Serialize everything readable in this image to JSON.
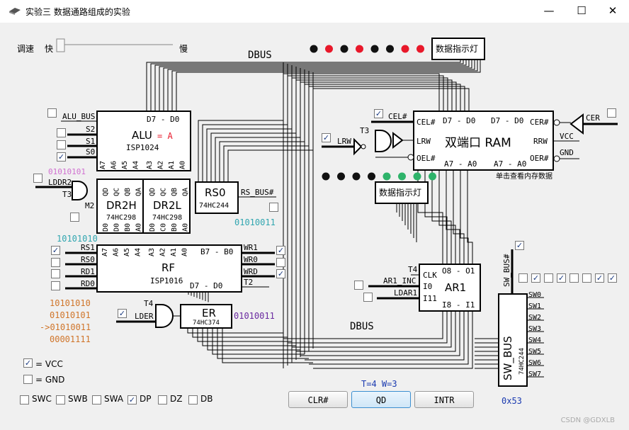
{
  "window": {
    "title": "实验三 数据通路组成的实验",
    "min": "—",
    "max": "☐",
    "close": "✕"
  },
  "speed": {
    "label": "调速",
    "fast": "快",
    "slow": "慢",
    "value": 0
  },
  "labels": {
    "dbus_top": "DBUS",
    "dbus_bottom": "DBUS",
    "indicator_top": "数据指示灯",
    "indicator_bottom": "数据指示灯",
    "alu_bus": "ALU_BUS",
    "s2": "S2",
    "s1": "S1",
    "s0": "S0",
    "alu_title": "ALU",
    "alu_eq": "= A",
    "alu_chip": "ISP1024",
    "alu_d": "D7 - D0",
    "alu_pins": [
      "A7",
      "A6",
      "A5",
      "A4",
      "A3",
      "A2",
      "A1",
      "A0"
    ],
    "bin_alu": "01010101",
    "lddr2": "LDDR2",
    "t3": "T3",
    "m2": "M2",
    "dr2h": "DR2H",
    "dr2l": "DR2L",
    "chip_298": "74HC298",
    "dr_top_pins": [
      "QD",
      "QC",
      "QB",
      "QA",
      "QD",
      "QC",
      "QB",
      "QA"
    ],
    "dr_bot_pins": [
      "D0",
      "D0",
      "B0",
      "A0",
      "D0",
      "C0",
      "B0",
      "A0"
    ],
    "rs0": "RS0",
    "rs0_chip": "74HC244",
    "rs_bus": "RS_BUS#",
    "rs0_val": "01010011",
    "rf_val": "10101010",
    "rs1": "RS1",
    "rs0_in": "RS0",
    "rd1": "RD1",
    "rd0": "RD0",
    "rf_title": "RF",
    "rf_chip": "ISP1016",
    "rf_d": "D7 - D0",
    "rf_b": "B7 - B0",
    "rf_pins": [
      "A7",
      "A6",
      "A5",
      "A4",
      "A3",
      "A2",
      "A1",
      "A0"
    ],
    "wr1": "WR1",
    "wr0": "WR0",
    "wrd": "WRD",
    "t2": "T2",
    "regs": [
      "10101010",
      "01010101",
      "->01010011",
      "00001111"
    ],
    "t4": "T4",
    "lder": "LDER",
    "er": "ER",
    "er_chip": "74HC374",
    "er_val": "01010011",
    "vcc_legend": "= VCC",
    "gnd_legend": "= GND",
    "cel": "CEL#",
    "lrw": "LRW",
    "t3b": "T3",
    "ram_title": "双端口 RAM",
    "ram_d1": "D7 - D0",
    "ram_d2": "D7 - D0",
    "ram_a1": "A7 - A0",
    "ram_a2": "A7 - A0",
    "ram_cel": "CEL#",
    "ram_lrw": "LRW",
    "ram_oel": "OEL#",
    "ram_cer": "CER#",
    "ram_rrw": "RRW",
    "ram_oer": "OER#",
    "cer": "CER",
    "vcc": "VCC",
    "gnd": "GND",
    "mem_hint": "单击查看内存数据",
    "ar1": "AR1",
    "ar1_inc": "AR1_INC",
    "ldar1": "LDAR1",
    "t4b": "T4",
    "ar1_clk": "CLK",
    "ar1_i0": "I0",
    "ar1_i11": "I11",
    "ar1_o": "O8 - O1",
    "ar1_i": "I8 - I1",
    "swbus": "SW_BUS",
    "swbus_chip": "74HC244",
    "swbus_en": "SW_BUS#",
    "sw": [
      "SW0",
      "SW1",
      "SW2",
      "SW3",
      "SW4",
      "SW5",
      "SW6",
      "SW7"
    ],
    "sw_val": "0x53",
    "tw": "T=4  W=3"
  },
  "checkboxes_bottom": [
    {
      "label": "SWC",
      "checked": false
    },
    {
      "label": "SWB",
      "checked": false
    },
    {
      "label": "SWA",
      "checked": false
    },
    {
      "label": "DP",
      "checked": true
    },
    {
      "label": "DZ",
      "checked": false
    },
    {
      "label": "DB",
      "checked": false
    }
  ],
  "switches": [
    false,
    true,
    false,
    true,
    false,
    false,
    true,
    true
  ],
  "leds_top": [
    "#111111",
    "#e8182a",
    "#111111",
    "#e8182a",
    "#111111",
    "#111111",
    "#e8182a",
    "#e8182a"
  ],
  "leds_bottom": [
    "#111111",
    "#111111",
    "#111111",
    "#111111",
    "#2eb36a",
    "#2eb36a",
    "#2eb36a",
    "#2eb36a"
  ],
  "buttons": {
    "clr": "CLR#",
    "qd": "QD",
    "intr": "INTR"
  },
  "watermark": "CSDN @GDXLB"
}
